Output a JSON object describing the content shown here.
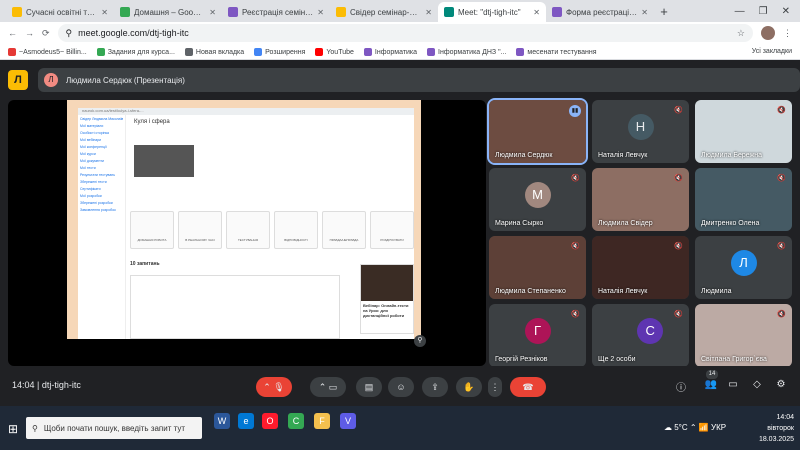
{
  "browser": {
    "tabs": [
      {
        "title": "Сучасні освітні тренди се",
        "color": "#fbbc04"
      },
      {
        "title": "Домашня – Google Диск",
        "color": "#34a853"
      },
      {
        "title": "Реєстрація семінару мат",
        "color": "#7e57c2"
      },
      {
        "title": "Свідер семінар-презентац",
        "color": "#fbbc04"
      },
      {
        "title": "Meet: \"dtj-tigh-itc\"",
        "color": "#00897b"
      },
      {
        "title": "Форма реєстрації учасн",
        "color": "#7e57c2"
      }
    ],
    "new_tab": "+",
    "url": "meet.google.com/dtj-tigh-itc",
    "bookmarks": [
      {
        "label": "~Asmodeus5~ Billin...",
        "color": "#e53935"
      },
      {
        "label": "Задания для курса...",
        "color": "#34a853"
      },
      {
        "label": "Новая вкладка",
        "color": "#5f6368"
      },
      {
        "label": "Розширення",
        "color": "#4285f4"
      },
      {
        "label": "YouTube",
        "color": "#ff0000"
      },
      {
        "label": "Інформатика",
        "color": "#7e57c2"
      },
      {
        "label": "Інформатика ДНЗ \"...",
        "color": "#7e57c2"
      },
      {
        "label": "месенати тестування",
        "color": "#7e57c2"
      }
    ],
    "bookmarks_right": "Усі закладки"
  },
  "meet": {
    "logo_letter": "Л",
    "presenter_initial": "Л",
    "presenter_label": "Людмила Сердюк (Презентація)",
    "time_code": "14:04 | dtj-tigh-itc",
    "participants_badge": "14",
    "participants": [
      {
        "name": "Людмила Сердюк",
        "type": "photo",
        "color": "#6d4c41",
        "speaking": true
      },
      {
        "name": "Наталія Левчук",
        "type": "initial",
        "initial": "Н",
        "bg": "#455a64",
        "fg": "#e8eaed"
      },
      {
        "name": "Людмила Бережна",
        "type": "photo",
        "color": "#cfd8dc"
      },
      {
        "name": "Марина Сырко",
        "type": "initial",
        "initial": "М",
        "bg": "#a1887f",
        "fg": "#ffffff"
      },
      {
        "name": "Людмила Свідер",
        "type": "photo",
        "color": "#8d6e63"
      },
      {
        "name": "Дмитренко Олена",
        "type": "photo",
        "color": "#455a64"
      },
      {
        "name": "Людмила Степаненко",
        "type": "photo",
        "color": "#5d4037"
      },
      {
        "name": "Наталія Левчук",
        "type": "photo",
        "color": "#3e2723"
      },
      {
        "name": "Людмила",
        "type": "initial",
        "initial": "Л",
        "bg": "#1e88e5",
        "fg": "#ffffff"
      },
      {
        "name": "Георгій Резніков",
        "type": "initial",
        "initial": "Г",
        "bg": "#ad1457",
        "fg": "#ffffff"
      },
      {
        "name": "Ще 2 особи",
        "type": "others",
        "initial": "С",
        "bg": "#5e35b1",
        "fg": "#ffffff"
      },
      {
        "name": "Світлана Григор`єва",
        "type": "photo",
        "color": "#bcaaa4"
      }
    ]
  },
  "shared": {
    "url": "naurok.com.ua/test/kulya-i-sfera-...",
    "title": "Куля і сфера",
    "sidebar": [
      "Свідер Людмила Миколаївна",
      "Мої матеріали",
      "Особисті сторінка",
      "Мої вебінари",
      "Мої конференції",
      "Мої курси",
      "Мої документи",
      "Мої тести",
      "Результати тестувань",
      "Збережені тести",
      "Сертифікати",
      "Мої розробки",
      "Збережені розробки",
      "Замовлення розробок"
    ],
    "cards": [
      "ДОМАШНЯ РОБОТА",
      "В РЕАЛЬНОМУ ЧАСІ",
      "ТЕСТУВАННЯ",
      "ВІДПОВІДНОСТІ",
      "ПРАВДА/НЕПРАВДА",
      "РОЗДРУКУВАТИ"
    ],
    "section": "10 запитань",
    "ad_title": "Вебінар: Онлайн-тести на Урок: для дистанційної роботи"
  },
  "taskbar": {
    "search_placeholder": "Щоби почати пошук, введіть запит тут",
    "weather": "5°C",
    "lang": "УКР",
    "time": "14:04",
    "day": "вівторок",
    "date": "18.03.2025",
    "apps": [
      {
        "label": "W",
        "color": "#2b579a"
      },
      {
        "label": "e",
        "color": "#0078d4"
      },
      {
        "label": "O",
        "color": "#ff1b2d"
      },
      {
        "label": "C",
        "color": "#34a853"
      },
      {
        "label": "F",
        "color": "#f4c04e"
      },
      {
        "label": "V",
        "color": "#5e5ce6"
      }
    ]
  }
}
